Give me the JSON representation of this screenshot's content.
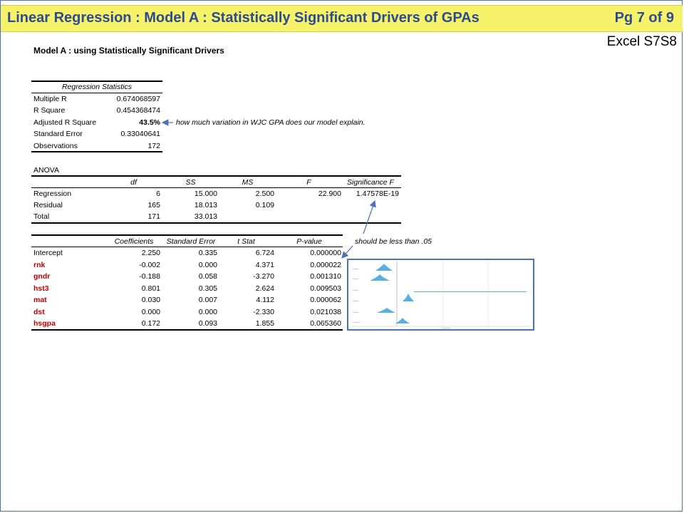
{
  "header": {
    "title": "Linear Regression : Model A : Statistically Significant Drivers of GPAs",
    "page": "Pg 7 of 9",
    "reference": "Excel S7S8"
  },
  "subtitle": "Model A : using Statistically Significant Drivers",
  "regression_statistics": {
    "heading": "Regression Statistics",
    "rows": [
      {
        "label": "Multiple R",
        "value": "0.674068597"
      },
      {
        "label": "R Square",
        "value": "0.454368474"
      },
      {
        "label": "Adjusted R Square",
        "value": "43.5%"
      },
      {
        "label": "Standard Error",
        "value": "0.33040641"
      },
      {
        "label": "Observations",
        "value": "172"
      }
    ],
    "adj_note": "how much variation in WJC GPA does our model explain."
  },
  "anova": {
    "label": "ANOVA",
    "headers": [
      "df",
      "SS",
      "MS",
      "F",
      "Significance F"
    ],
    "rows": [
      {
        "label": "Regression",
        "df": "6",
        "ss": "15.000",
        "ms": "2.500",
        "f": "22.900",
        "sig": "1.47578E-19"
      },
      {
        "label": "Residual",
        "df": "165",
        "ss": "18.013",
        "ms": "0.109",
        "f": "",
        "sig": ""
      },
      {
        "label": "Total",
        "df": "171",
        "ss": "33.013",
        "ms": "",
        "f": "",
        "sig": ""
      }
    ],
    "sig_note": "should be less than .05"
  },
  "coefficients": {
    "headers": [
      "Coefficients",
      "Standard Error",
      "t Stat",
      "P-value"
    ],
    "rows": [
      {
        "label": "Intercept",
        "coef": "2.250",
        "se": "0.335",
        "t": "6.724",
        "p": "0.000000",
        "highlight": false
      },
      {
        "label": "rnk",
        "coef": "-0.002",
        "se": "0.000",
        "t": "4.371",
        "p": "0.000022",
        "highlight": true
      },
      {
        "label": "gndr",
        "coef": "-0.188",
        "se": "0.058",
        "t": "-3.270",
        "p": "0.001310",
        "highlight": true
      },
      {
        "label": "hst3",
        "coef": "0.801",
        "se": "0.305",
        "t": "2.624",
        "p": "0.009503",
        "highlight": true
      },
      {
        "label": "mat",
        "coef": "0.030",
        "se": "0.007",
        "t": "4.112",
        "p": "0.000062",
        "highlight": true
      },
      {
        "label": "dst",
        "coef": "0.000",
        "se": "0.000",
        "t": "-2.330",
        "p": "0.021038",
        "highlight": true
      },
      {
        "label": "hsgpa",
        "coef": "0.172",
        "se": "0.093",
        "t": "1.855",
        "p": "0.065360",
        "highlight": true
      }
    ]
  },
  "colors": {
    "banner_bg": "#f6f36a",
    "banner_text": "#2e4a8e",
    "driver_red": "#c00000",
    "arrow_blue": "#4a72b8",
    "distribution_fill": "#5aaee0"
  }
}
